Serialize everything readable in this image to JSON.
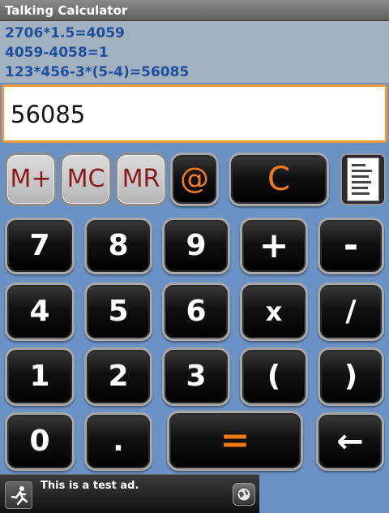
{
  "app": {
    "title": "Talking Calculator"
  },
  "history": [
    "2706*1.5=4059",
    "4059-4058=1",
    "123*456-3*(5-4)=56085"
  ],
  "display": {
    "value": "56085"
  },
  "keys": {
    "m_plus": "M+",
    "mc": "MC",
    "mr": "MR",
    "at": "@",
    "clear": "C",
    "seven": "7",
    "eight": "8",
    "nine": "9",
    "plus": "+",
    "minus": "-",
    "four": "4",
    "five": "5",
    "six": "6",
    "multiply": "x",
    "divide": "/",
    "one": "1",
    "two": "2",
    "three": "3",
    "paren_open": "(",
    "paren_close": ")",
    "zero": "0",
    "dot": ".",
    "equals": "=",
    "backspace": "←"
  },
  "ad": {
    "text": "This is a test ad."
  },
  "colors": {
    "background": "#6b92c4",
    "history_text": "#1e4f9c",
    "display_border": "#f39a36",
    "accent_orange": "#f27a1a",
    "memory_text": "#8b1a1a"
  },
  "icons": {
    "notes": "notes-icon",
    "ad": "running-figure-icon",
    "globe": "globe-icon"
  }
}
